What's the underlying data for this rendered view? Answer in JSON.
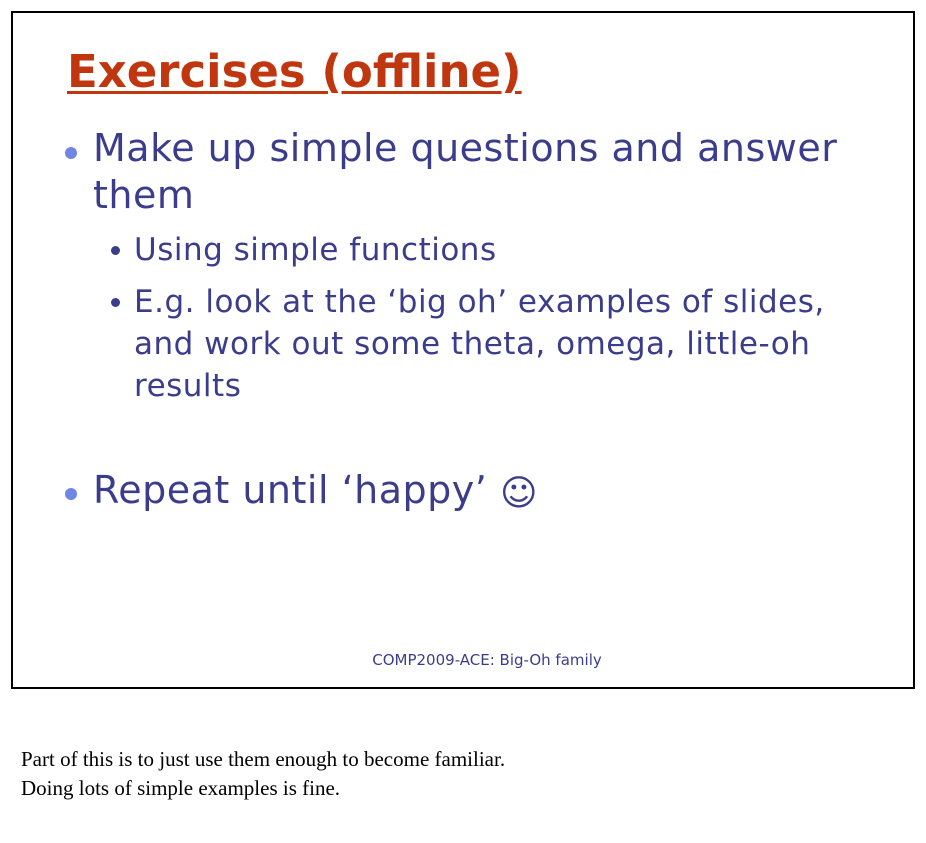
{
  "slide": {
    "title": "Exercises  (offline)",
    "bullets": [
      {
        "text": "Make up simple questions and answer them",
        "sub": [
          "Using simple functions",
          "E.g. look at the ‘big oh’ examples of slides, and work out some theta, omega, little-oh results"
        ]
      },
      {
        "text": "Repeat until ‘happy’",
        "emoji": "☺"
      }
    ],
    "footer": "COMP2009-ACE: Big-Oh family"
  },
  "notes": {
    "line1": "Part of this is to just use them enough to become familiar.",
    "line2": "Doing lots of simple examples is fine."
  },
  "colors": {
    "title": "#c0360f",
    "body_text": "#3b3d8c",
    "bullet_l1": "#6f86e6"
  }
}
